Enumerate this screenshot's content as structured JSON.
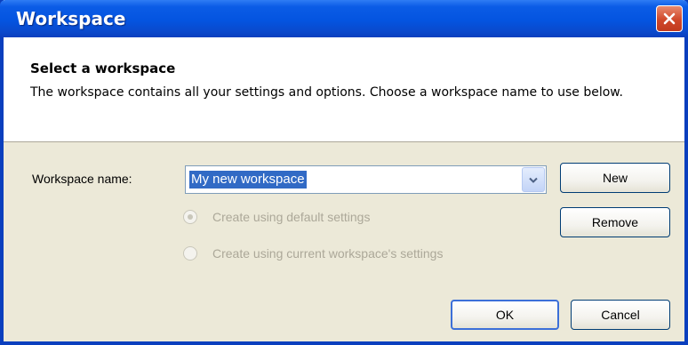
{
  "window": {
    "title": "Workspace"
  },
  "header": {
    "title": "Select a workspace",
    "description": "The workspace contains all your settings and options. Choose a workspace name to use below."
  },
  "form": {
    "workspace_label": "Workspace name:",
    "workspace_value": "My new workspace",
    "options": [
      {
        "label": "Create using default settings",
        "selected": true,
        "enabled": false
      },
      {
        "label": "Create using current workspace's settings",
        "selected": false,
        "enabled": false
      }
    ]
  },
  "buttons": {
    "new": "New",
    "remove": "Remove",
    "ok": "OK",
    "cancel": "Cancel"
  },
  "icons": {
    "close": "close-icon",
    "dropdown": "chevron-down-icon"
  },
  "colors": {
    "title_bar": "#0454e0",
    "close_button": "#d0482a",
    "selection": "#316ac5",
    "dialog_bg": "#ece9d8"
  }
}
